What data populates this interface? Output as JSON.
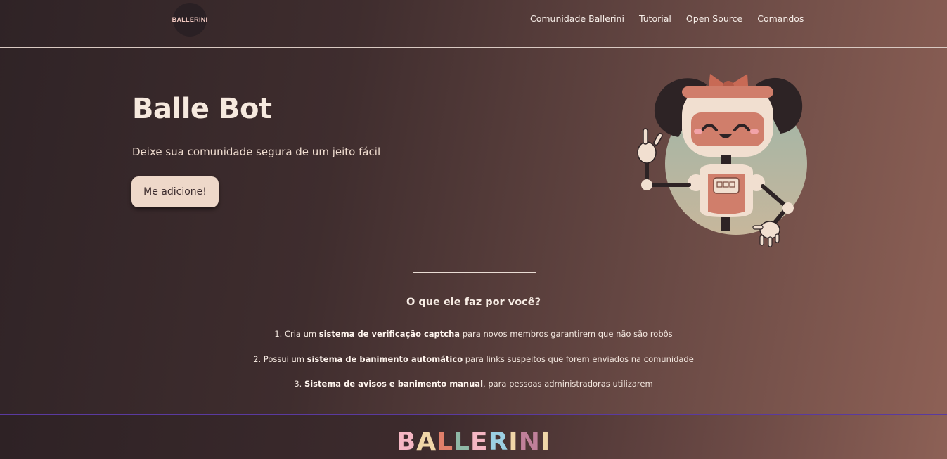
{
  "header": {
    "logo_text": "BALLERINI",
    "nav": [
      {
        "label": "Comunidade Ballerini"
      },
      {
        "label": "Tutorial"
      },
      {
        "label": "Open Source"
      },
      {
        "label": "Comandos"
      }
    ]
  },
  "hero": {
    "title": "Balle Bot",
    "subtitle": "Deixe sua comunidade segura de um jeito fácil",
    "cta_label": "Me adicione!",
    "illustration_icon": "robot-illustration"
  },
  "features": {
    "title": "O que ele faz por você?",
    "items": [
      {
        "prefix": "1. Cria um ",
        "bold": "sistema de verificação captcha",
        "suffix": " para novos membros garantirem que não são robôs"
      },
      {
        "prefix": "2. Possui um ",
        "bold": "sistema de banimento automático",
        "suffix": " para links suspeitos que forem enviados na comunidade"
      },
      {
        "prefix": "3. ",
        "bold": "Sistema de avisos e banimento manual",
        "suffix": ", para pessoas administradoras utilizarem"
      }
    ]
  },
  "footer": {
    "logo_letters": [
      "B",
      "A",
      "L",
      "L",
      "E",
      "R",
      "I",
      "N",
      "I"
    ],
    "logo_colors": [
      "#f5b6c3",
      "#f0d6a8",
      "#e07f6a",
      "#8fb8a6",
      "#f5b6c3",
      "#9ccfe3",
      "#f0d6a8",
      "#c0809a",
      "#f0d6a8"
    ]
  },
  "colors": {
    "background_start": "#2f2326",
    "background_end": "#8e6156",
    "button_bg": "#eed8c9",
    "text_light": "#f6e9de"
  }
}
